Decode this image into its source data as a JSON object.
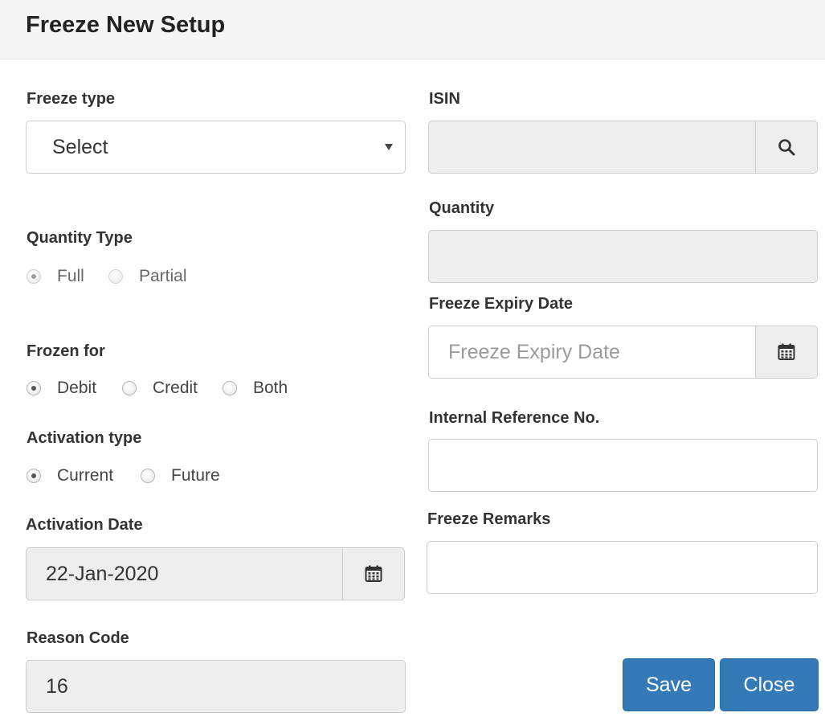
{
  "dialog": {
    "title": "Freeze New Setup"
  },
  "freeze_type": {
    "label": "Freeze type",
    "value": "Select"
  },
  "isin": {
    "label": "ISIN",
    "value": "",
    "search_icon": "search-icon"
  },
  "quantity": {
    "label": "Quantity",
    "value": ""
  },
  "quantity_type": {
    "label": "Quantity Type",
    "options": [
      "Full",
      "Partial"
    ],
    "selected": "Full",
    "disabled": true
  },
  "freeze_expiry_date": {
    "label": "Freeze Expiry Date",
    "placeholder": "Freeze Expiry Date",
    "value": "",
    "calendar_icon": "calendar-icon"
  },
  "frozen_for": {
    "label": "Frozen for",
    "options": [
      "Debit",
      "Credit",
      "Both"
    ],
    "selected": "Debit"
  },
  "internal_reference": {
    "label": "Internal Reference No.",
    "value": ""
  },
  "activation_type": {
    "label": "Activation type",
    "options": [
      "Current",
      "Future"
    ],
    "selected": "Current"
  },
  "freeze_remarks": {
    "label": "Freeze Remarks",
    "value": ""
  },
  "activation_date": {
    "label": "Activation Date",
    "value": "22-Jan-2020",
    "calendar_icon": "calendar-icon"
  },
  "reason_code": {
    "label": "Reason Code",
    "value": "16"
  },
  "buttons": {
    "save": "Save",
    "close": "Close"
  },
  "colors": {
    "primary_button": "#337ab7",
    "readonly_field": "#eeeeee",
    "header_bg": "#f5f5f5"
  }
}
